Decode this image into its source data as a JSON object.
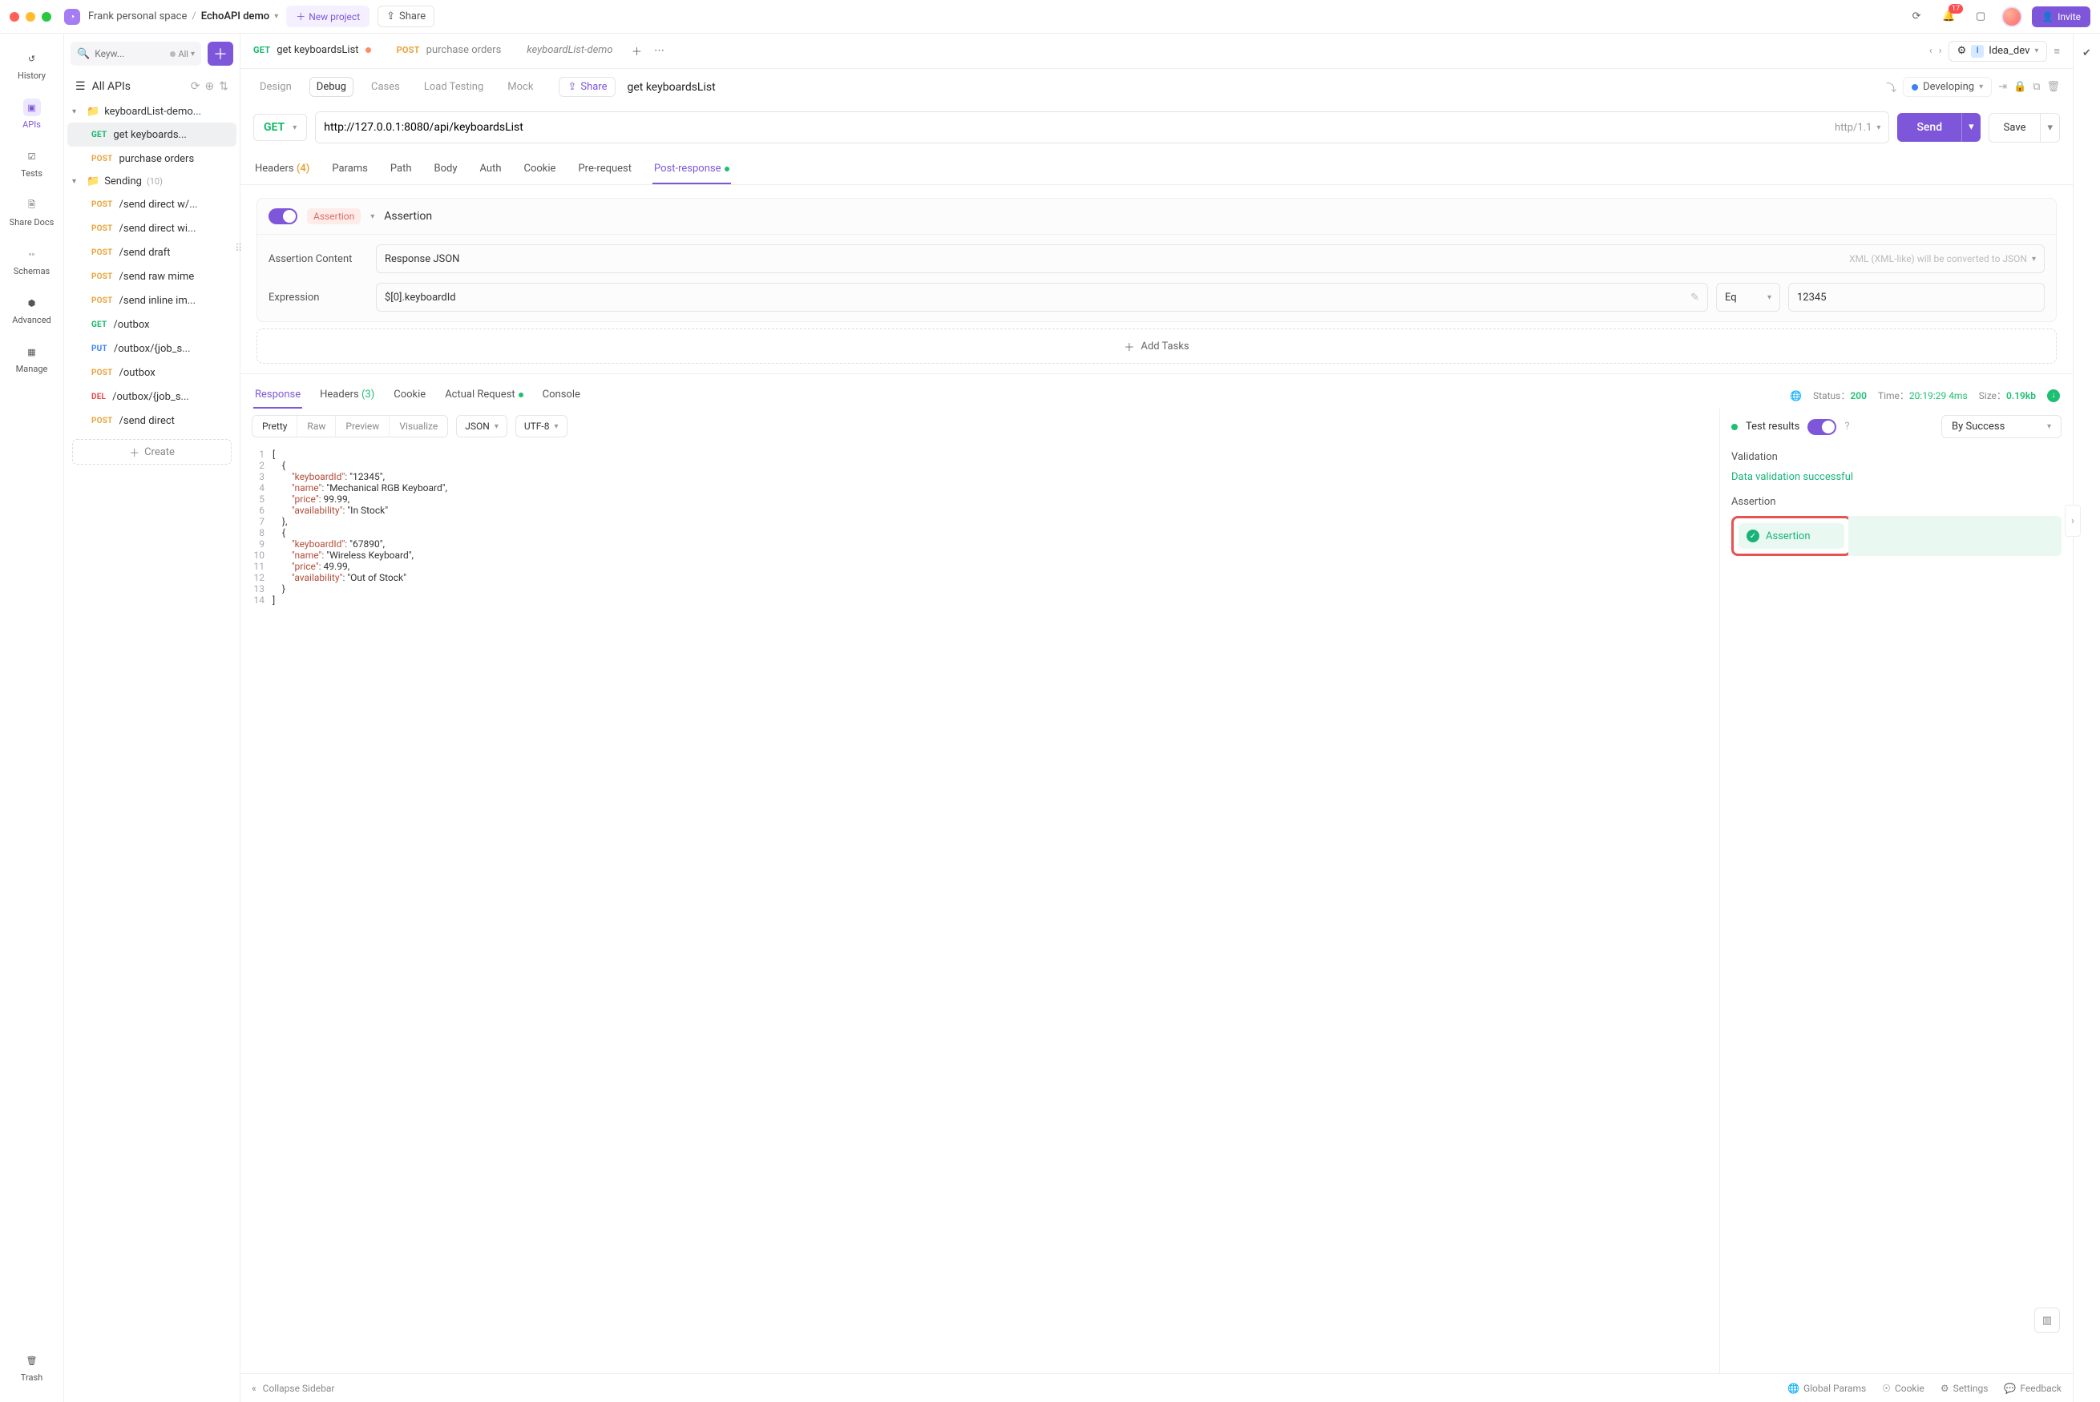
{
  "topbar": {
    "workspace": "Frank personal space",
    "project": "EchoAPI demo",
    "new_project": "New project",
    "share": "Share",
    "notification_count": "17",
    "invite": "Invite"
  },
  "rail": {
    "history": "History",
    "apis": "APIs",
    "tests": "Tests",
    "share_docs": "Share Docs",
    "schemas": "Schemas",
    "advanced": "Advanced",
    "manage": "Manage",
    "trash": "Trash"
  },
  "sidebar": {
    "search_placeholder": "Keyw...",
    "all_label": "All",
    "all_apis": "All APIs",
    "create": "Create",
    "groups": [
      {
        "name": "keyboardList-demo...",
        "items": [
          {
            "method": "GET",
            "cls": "m-get",
            "label": "get keyboards...",
            "active": true
          },
          {
            "method": "POST",
            "cls": "m-post",
            "label": "purchase orders"
          }
        ]
      },
      {
        "name": "Sending",
        "count": "(10)",
        "items": [
          {
            "method": "POST",
            "cls": "m-post",
            "label": "/send direct w/..."
          },
          {
            "method": "POST",
            "cls": "m-post",
            "label": "/send direct wi..."
          },
          {
            "method": "POST",
            "cls": "m-post",
            "label": "/send draft"
          },
          {
            "method": "POST",
            "cls": "m-post",
            "label": "/send raw mime"
          },
          {
            "method": "POST",
            "cls": "m-post",
            "label": "/send inline im..."
          },
          {
            "method": "GET",
            "cls": "m-get",
            "label": "/outbox"
          },
          {
            "method": "PUT",
            "cls": "m-put",
            "label": "/outbox/{job_s..."
          },
          {
            "method": "POST",
            "cls": "m-post",
            "label": "/outbox"
          },
          {
            "method": "DEL",
            "cls": "m-del",
            "label": "/outbox/{job_s..."
          },
          {
            "method": "POST",
            "cls": "m-post",
            "label": "/send direct"
          }
        ]
      }
    ]
  },
  "tabs": [
    {
      "method": "GET",
      "cls": "m-get",
      "label": "get keyboardsList",
      "unsaved": true,
      "active": true
    },
    {
      "method": "POST",
      "cls": "m-post",
      "label": "purchase orders"
    },
    {
      "italic": true,
      "label": "keyboardList-demo"
    }
  ],
  "env": {
    "name": "Idea_dev"
  },
  "subbar": {
    "design": "Design",
    "debug": "Debug",
    "cases": "Cases",
    "load": "Load Testing",
    "mock": "Mock",
    "share": "Share",
    "title": "get keyboardsList",
    "developing": "Developing"
  },
  "request": {
    "method": "GET",
    "url": "http://127.0.0.1:8080/api/keyboardsList",
    "protocol": "http/1.1",
    "send": "Send",
    "save": "Save"
  },
  "req_tabs": {
    "headers": "Headers",
    "headers_count": "(4)",
    "params": "Params",
    "path": "Path",
    "body": "Body",
    "auth": "Auth",
    "cookie": "Cookie",
    "pre": "Pre-request",
    "post": "Post-response"
  },
  "assertion": {
    "badge": "Assertion",
    "title": "Assertion",
    "content_label": "Assertion Content",
    "content_value": "Response JSON",
    "xml_hint": "XML (XML-like) will be converted to JSON",
    "expression_label": "Expression",
    "expression_value": "$[0].keyboardId",
    "op": "Eq",
    "value": "12345",
    "add_tasks": "Add Tasks"
  },
  "response": {
    "tabs": {
      "response": "Response",
      "headers": "Headers",
      "headers_count": "(3)",
      "cookie": "Cookie",
      "actual": "Actual Request",
      "console": "Console"
    },
    "status_label": "Status：",
    "status": "200",
    "time_label": "Time：",
    "time": "20:19:29",
    "duration": "4ms",
    "size_label": "Size：",
    "size": "0.19kb",
    "modes": {
      "pretty": "Pretty",
      "raw": "Raw",
      "preview": "Preview",
      "visualize": "Visualize"
    },
    "format": "JSON",
    "charset": "UTF-8",
    "code_lines": [
      "[",
      "    {",
      "        \"keyboardId\": \"12345\",",
      "        \"name\": \"Mechanical RGB Keyboard\",",
      "        \"price\": 99.99,",
      "        \"availability\": \"In Stock\"",
      "    },",
      "    {",
      "        \"keyboardId\": \"67890\",",
      "        \"name\": \"Wireless Keyboard\",",
      "        \"price\": 49.99,",
      "        \"availability\": \"Out of Stock\"",
      "    }",
      "]"
    ]
  },
  "test_results": {
    "title": "Test results",
    "by": "By Success",
    "validation_label": "Validation",
    "validation_msg": "Data validation successful",
    "assertion_label": "Assertion",
    "assertion_item": "Assertion"
  },
  "footer": {
    "collapse": "Collapse Sidebar",
    "global": "Global Params",
    "cookie": "Cookie",
    "settings": "Settings",
    "feedback": "Feedback"
  }
}
